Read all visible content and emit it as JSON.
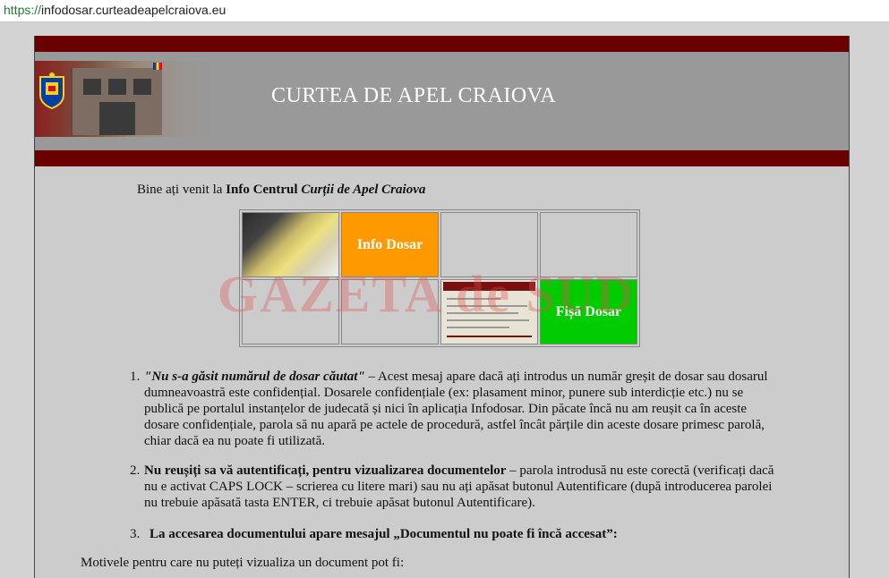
{
  "browser": {
    "url_scheme": "https://",
    "url_host": "infodosar.curteadeapelcraiova.eu"
  },
  "banner": {
    "title": "CURTEA DE APEL CRAIOVA"
  },
  "welcome": {
    "prefix": "Bine ați venit la ",
    "bold": "Info Centrul ",
    "italic": "Curții de Apel Craiova"
  },
  "tiles": {
    "info_dosar": "Info Dosar",
    "fisa_dosar": "Fișă Dosar"
  },
  "watermark": "GAZETA de SUD",
  "items": [
    {
      "number": "1.",
      "lead": "\"Nu s-a găsit numărul de dosar căutat\"",
      "text": " – Acest mesaj apare dacă ați introdus un număr greșit de dosar sau dosarul dumneavoastră este confidențial. Dosarele confidențiale (ex: plasament minor, punere sub interdicție etc.) nu se publică pe portalul instanțelor de judecată și nici în aplicația Infodosar. Din păcate încă nu am reușit ca în aceste dosare confidențiale, parola să nu apară pe actele de procedură, astfel încât părțile din aceste dosare primesc parolă, chiar dacă ea nu poate fi utilizată."
    },
    {
      "number": "2.",
      "lead": "Nu reușiți sa vă autentificați, pentru vizualizarea documentelor",
      "text": " – parola introdusă nu este corectă (verificați dacă nu e activat CAPS LOCK – scrierea cu litere mari) sau nu ați apăsat butonul Autentificare (după introducerea parolei nu trebuie apăsată tasta ENTER, ci trebuie apăsat butonul Autentificare)."
    },
    {
      "number": "3.",
      "lead": "La accesarea documentului apare mesajul „Documentul nu poate fi încă accesat”:",
      "text": ""
    }
  ],
  "motive": "Motivele pentru care nu puteți vizualiza un document pot fi:",
  "colors": {
    "maroon": "#6b0000",
    "banner_gray": "#999999",
    "orange": "#ff9900",
    "green": "#00cc00",
    "page_bg": "#cccccc"
  }
}
